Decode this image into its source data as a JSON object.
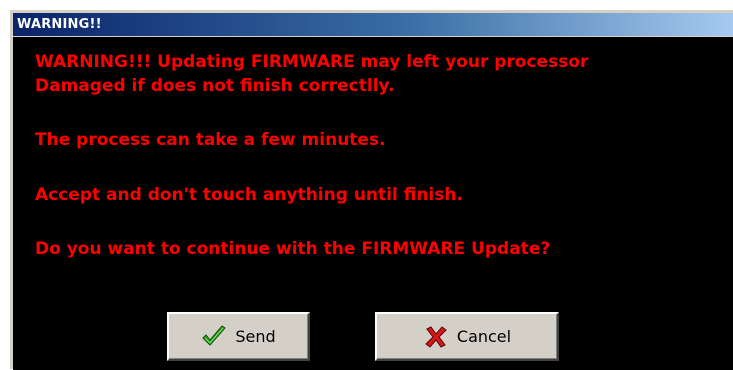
{
  "window": {
    "title": "WARNING!!"
  },
  "message": {
    "line1": "WARNING!!! Updating FIRMWARE may left your processor",
    "line2": "Damaged if does not finish correctlly.",
    "line3": "The process can take a few minutes.",
    "line4": "Accept and don't touch anything until finish.",
    "line5": "Do you want to continue with the FIRMWARE Update?"
  },
  "buttons": {
    "send_label": "Send",
    "send_icon": "green-checkmark-icon",
    "cancel_label": "Cancel",
    "cancel_icon": "red-x-icon"
  },
  "colors": {
    "message_text": "#ff0000",
    "background": "#000000",
    "titlebar_start": "#0a246a",
    "titlebar_end": "#a6caf0"
  }
}
